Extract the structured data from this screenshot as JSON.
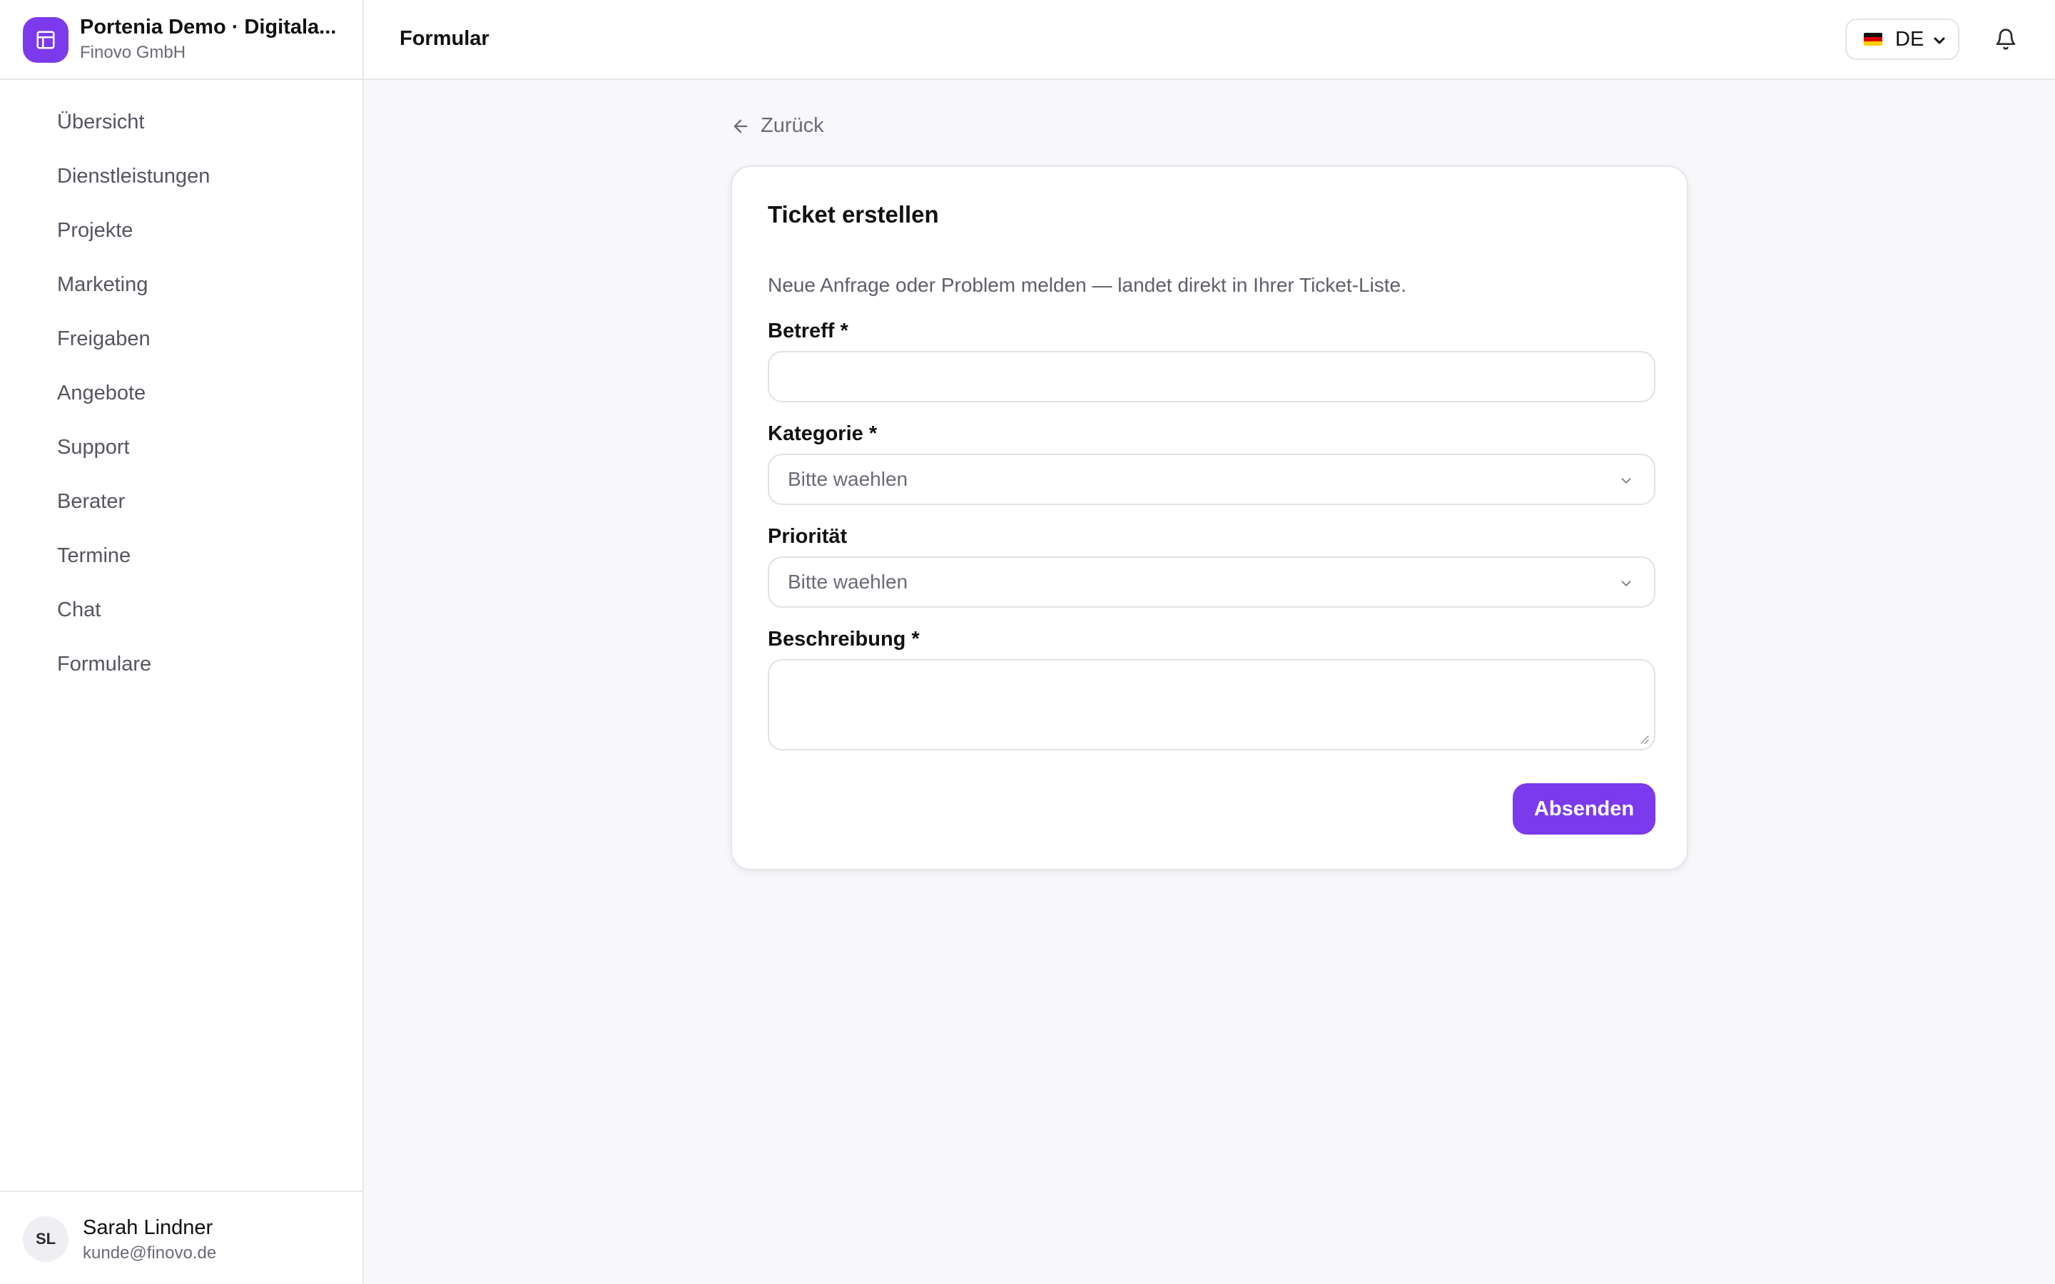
{
  "brand": {
    "title": "Portenia Demo · Digitala...",
    "subtitle": "Finovo GmbH",
    "logo_icon": "layout-panel-icon",
    "accent": "#7c3aed"
  },
  "sidebar": {
    "items": [
      {
        "label": "Übersicht"
      },
      {
        "label": "Dienstleistungen"
      },
      {
        "label": "Projekte"
      },
      {
        "label": "Marketing"
      },
      {
        "label": "Freigaben"
      },
      {
        "label": "Angebote"
      },
      {
        "label": "Support"
      },
      {
        "label": "Berater"
      },
      {
        "label": "Termine"
      },
      {
        "label": "Chat"
      },
      {
        "label": "Formulare"
      }
    ]
  },
  "user": {
    "initials": "SL",
    "name": "Sarah Lindner",
    "email": "kunde@finovo.de"
  },
  "header": {
    "title": "Formular",
    "language": "DE",
    "language_flag_icon": "germany-flag-icon",
    "notifications_icon": "bell-icon"
  },
  "back": {
    "label": "Zurück",
    "icon": "arrow-left-icon"
  },
  "form": {
    "title": "Ticket erstellen",
    "description": "Neue Anfrage oder Problem melden — landet direkt in Ihrer Ticket-Liste.",
    "fields": {
      "subject": {
        "label": "Betreff *",
        "value": ""
      },
      "category": {
        "label": "Kategorie *",
        "value": "Bitte waehlen"
      },
      "priority": {
        "label": "Priorität",
        "value": "Bitte waehlen"
      },
      "description": {
        "label": "Beschreibung *",
        "value": ""
      }
    },
    "submit_label": "Absenden"
  }
}
